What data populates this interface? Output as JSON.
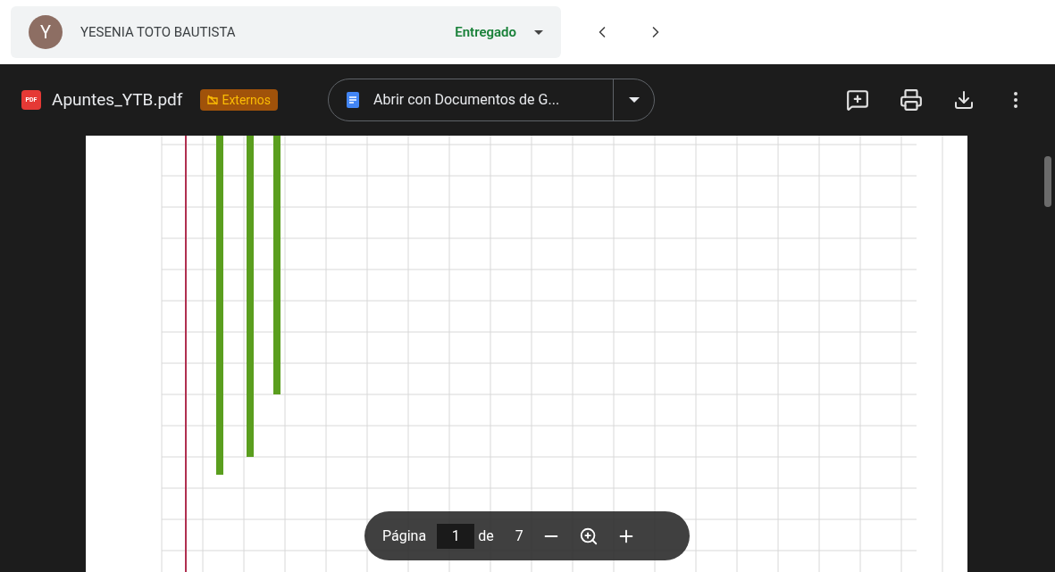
{
  "student": {
    "initial": "Y",
    "name": "YESENIA TOTO BAUTISTA",
    "status": "Entregado"
  },
  "viewer": {
    "file_icon": "PDF",
    "file_name": "Apuntes_YTB.pdf",
    "badge": "Externos",
    "open_with": "Abrir con Documentos de G..."
  },
  "page_controls": {
    "label": "Página",
    "page": "1",
    "of": "de",
    "total": "7"
  }
}
